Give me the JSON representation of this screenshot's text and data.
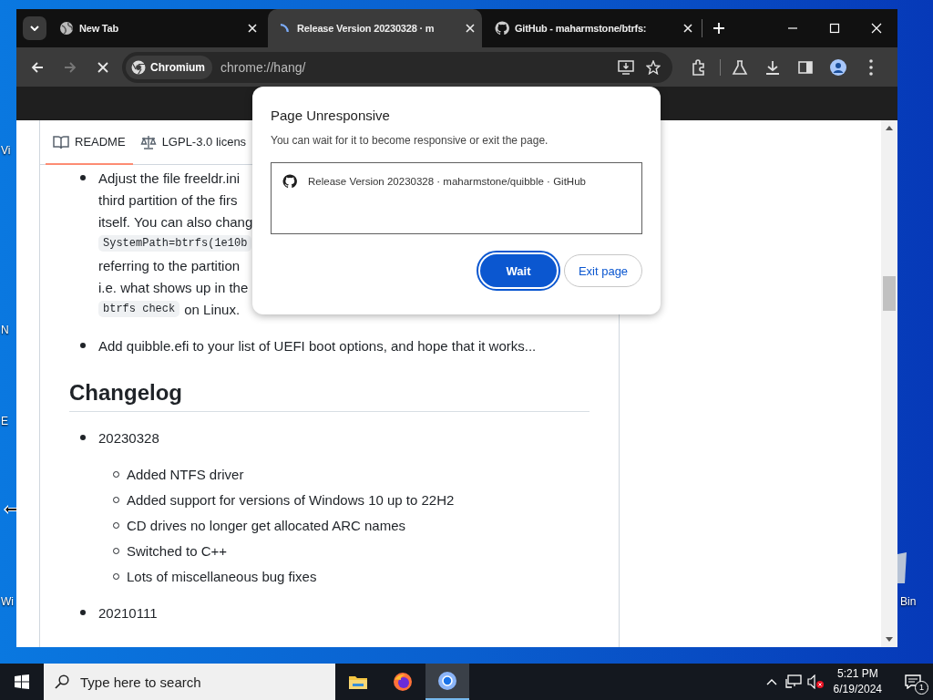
{
  "desktop": {
    "icons": [
      {
        "label": "Vi"
      },
      {
        "label": "N"
      },
      {
        "label": "E"
      },
      {
        "label": "Wi"
      },
      {
        "label": "Bin"
      }
    ]
  },
  "browser": {
    "tabs": [
      {
        "title": "New Tab",
        "selected": false
      },
      {
        "title": "Release Version 20230328 · m",
        "selected": true
      },
      {
        "title": "GitHub - maharmstone/btrfs:",
        "selected": false
      }
    ],
    "nav": [
      {
        "kind": "back",
        "disabled": false
      },
      {
        "kind": "forward",
        "disabled": true
      },
      {
        "kind": "stop",
        "disabled": false
      }
    ],
    "address": {
      "chip": "Chromium",
      "url": "chrome://hang/"
    }
  },
  "readme": {
    "tabs": [
      {
        "label": "README",
        "selected": true
      },
      {
        "label": "LGPL-3.0 licens",
        "selected": false
      }
    ],
    "sections": [
      {
        "kind": "list",
        "items": [
          {
            "lines": [
              [
                {
                  "kind": "text",
                  "text": "Adjust the file freeldr.ini"
                }
              ],
              [
                {
                  "kind": "text",
                  "text": "third partition of the firs"
                }
              ],
              [
                {
                  "kind": "text",
                  "text": "itself. You can also chang"
                }
              ],
              [
                {
                  "kind": "code",
                  "text": "SystemPath=btrfs(1e10b"
                }
              ],
              [
                {
                  "kind": "text",
                  "text": "referring to the partition"
                }
              ],
              [
                {
                  "kind": "text",
                  "text": "i.e. what shows up in the"
                }
              ],
              [
                {
                  "kind": "code",
                  "text": "btrfs check"
                },
                {
                  "kind": "text",
                  "text": "on Linux."
                }
              ]
            ]
          },
          {
            "lines": [
              [
                {
                  "kind": "text",
                  "text": "Add quibble.efi to your list of UEFI boot options, and hope that it works..."
                }
              ]
            ]
          }
        ]
      },
      {
        "kind": "heading",
        "text": "Changelog"
      },
      {
        "kind": "list",
        "items": [
          {
            "lines": [
              [
                {
                  "kind": "text",
                  "text": "20230328"
                }
              ]
            ],
            "children": [
              {
                "lines": [
                  [
                    {
                      "kind": "text",
                      "text": "Added NTFS driver"
                    }
                  ]
                ]
              },
              {
                "lines": [
                  [
                    {
                      "kind": "text",
                      "text": "Added support for versions of Windows 10 up to 22H2"
                    }
                  ]
                ]
              },
              {
                "lines": [
                  [
                    {
                      "kind": "text",
                      "text": "CD drives no longer get allocated ARC names"
                    }
                  ]
                ]
              },
              {
                "lines": [
                  [
                    {
                      "kind": "text",
                      "text": "Switched to C++"
                    }
                  ]
                ]
              },
              {
                "lines": [
                  [
                    {
                      "kind": "text",
                      "text": "Lots of miscellaneous bug fixes"
                    }
                  ]
                ]
              }
            ]
          },
          {
            "lines": [
              [
                {
                  "kind": "text",
                  "text": "20210111"
                }
              ]
            ]
          }
        ]
      }
    ]
  },
  "dialog": {
    "title": "Page Unresponsive",
    "message": "You can wait for it to become responsive or exit the page.",
    "pages": [
      {
        "title": "Release Version 20230328 · maharmstone/quibble · GitHub"
      }
    ],
    "buttons": [
      {
        "label": "Wait",
        "kind": "primary",
        "focused": true
      },
      {
        "label": "Exit page",
        "kind": "secondary",
        "focused": false
      }
    ]
  },
  "taskbar": {
    "search_placeholder": "Type here to search",
    "apps": [
      {
        "kind": "explorer",
        "active": false
      },
      {
        "kind": "firefox",
        "active": false
      },
      {
        "kind": "chromium",
        "active": true
      }
    ],
    "volume_muted": true,
    "time": "5:21 PM",
    "date": "6/19/2024",
    "notifications": "1"
  }
}
